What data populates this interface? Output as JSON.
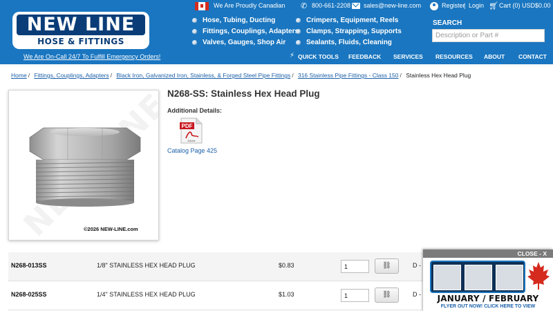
{
  "brand": {
    "name_top": "NEW LINE",
    "name_bottom": "HOSE & FITTINGS",
    "oncall": "We Are On-Call 24/7 To Fulfill Emergency Orders!",
    "copyright": "©2026 NEW-LINE.com",
    "watermark": "NEW LINE"
  },
  "topbar": {
    "canadian": "We Are Proudly Canadian",
    "phone": "800-661-2208",
    "email": "sales@new-line.com",
    "register": "Register",
    "separator": "|",
    "login": "Login",
    "cart": "Cart (0) USD$0.00"
  },
  "categories": [
    "Hose, Tubing, Ducting",
    "Fittings, Couplings, Adapters",
    "Valves, Gauges, Shop Air",
    "Crimpers, Equipment, Reels",
    "Clamps, Strapping, Supports",
    "Sealants, Fluids, Cleaning"
  ],
  "search": {
    "label": "SEARCH",
    "placeholder": "Description or Part #"
  },
  "nav": [
    "QUICK TOOLS",
    "FEEDBACK",
    "SERVICES",
    "RESOURCES",
    "ABOUT",
    "CONTACT"
  ],
  "breadcrumb": [
    "Home",
    "Fittings, Couplings, Adapters",
    "Black Iron, Galvanized Iron, Stainless, & Forged Steel Pipe Fittings",
    "316 Stainless Pipe Fittings - Class 150",
    "Stainless Hex Head Plug"
  ],
  "product": {
    "title": "N268-SS: Stainless Hex Head Plug",
    "details_label": "Additional Details:",
    "pdf_label": "PDF",
    "pdf_brand": "Adobe",
    "catalog_link": "Catalog Page 425"
  },
  "rows": [
    {
      "sku": "N268-013SS",
      "desc": "1/8\" STAINLESS HEX HEAD PLUG",
      "price": "$0.83",
      "qty": "1",
      "extra": "D -"
    },
    {
      "sku": "N268-025SS",
      "desc": "1/4\" STAINLESS HEX HEAD PLUG",
      "price": "$1.03",
      "qty": "1",
      "extra": "D -"
    }
  ],
  "flyer": {
    "close": "CLOSE - X",
    "months": "JANUARY / FEBRUARY",
    "subtitle": "FLYER OUT NOW! CLICK HERE TO VIEW"
  },
  "colors": {
    "header_blue": "#1a76c0",
    "link_blue": "#1a5fa8",
    "logo_navy": "#0a3d78",
    "canada_red": "#d52b1e"
  }
}
